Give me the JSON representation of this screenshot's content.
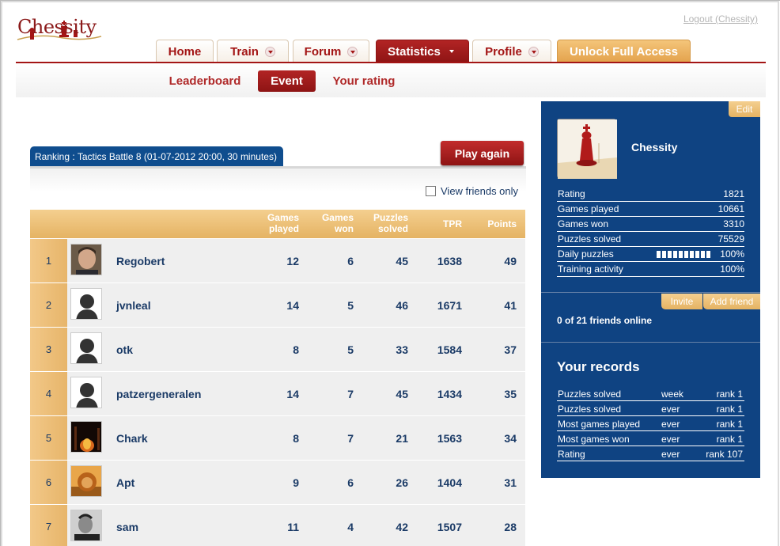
{
  "header": {
    "logo_text": "Chessity",
    "logout": "Logout (Chessity)"
  },
  "nav": {
    "tabs": [
      {
        "label": "Home",
        "dropdown": false,
        "active": false
      },
      {
        "label": "Train",
        "dropdown": true,
        "active": false
      },
      {
        "label": "Forum",
        "dropdown": true,
        "active": false
      },
      {
        "label": "Statistics",
        "dropdown": true,
        "active": true
      },
      {
        "label": "Profile",
        "dropdown": true,
        "active": false
      },
      {
        "label": "Unlock Full Access",
        "dropdown": false,
        "active": false
      }
    ],
    "subtabs": [
      {
        "label": "Leaderboard",
        "active": false
      },
      {
        "label": "Event",
        "active": true
      },
      {
        "label": "Your rating",
        "active": false
      }
    ]
  },
  "ranking": {
    "label": "Ranking : Tactics Battle 8 (01-07-2012 20:00, 30 minutes)",
    "play_again": "Play again",
    "view_friends": "View friends only",
    "view_friends_checked": false
  },
  "table": {
    "headers": {
      "games_played": [
        "Games",
        "played"
      ],
      "games_won": [
        "Games",
        "won"
      ],
      "puzzles_solved": [
        "Puzzles",
        "solved"
      ],
      "tpr": "TPR",
      "points": "Points"
    },
    "rows": [
      {
        "rank": "1",
        "name": "Regobert",
        "avatar": "photo-man",
        "played": "12",
        "won": "6",
        "solved": "45",
        "tpr": "1638",
        "points": "49"
      },
      {
        "rank": "2",
        "name": "jvnleal",
        "avatar": "silhouette",
        "played": "14",
        "won": "5",
        "solved": "46",
        "tpr": "1671",
        "points": "41"
      },
      {
        "rank": "3",
        "name": "otk",
        "avatar": "silhouette",
        "played": "8",
        "won": "5",
        "solved": "33",
        "tpr": "1584",
        "points": "37"
      },
      {
        "rank": "4",
        "name": "patzergeneralen",
        "avatar": "silhouette",
        "played": "14",
        "won": "7",
        "solved": "45",
        "tpr": "1434",
        "points": "35"
      },
      {
        "rank": "5",
        "name": "Chark",
        "avatar": "photo-fire",
        "played": "8",
        "won": "7",
        "solved": "21",
        "tpr": "1563",
        "points": "34"
      },
      {
        "rank": "6",
        "name": "Apt",
        "avatar": "photo-lion",
        "played": "9",
        "won": "6",
        "solved": "26",
        "tpr": "1404",
        "points": "31"
      },
      {
        "rank": "7",
        "name": "sam",
        "avatar": "photo-bw",
        "played": "11",
        "won": "4",
        "solved": "42",
        "tpr": "1507",
        "points": "28"
      }
    ]
  },
  "sidebar": {
    "edit": "Edit",
    "profile_name": "Chessity",
    "stats": [
      {
        "label": "Rating",
        "value": "1821"
      },
      {
        "label": "Games played",
        "value": "10661"
      },
      {
        "label": "Games won",
        "value": "3310"
      },
      {
        "label": "Puzzles solved",
        "value": "75529"
      },
      {
        "label": "Daily puzzles",
        "value": "100%",
        "meter_fraction": 1.0
      },
      {
        "label": "Training activity",
        "value": "100%"
      }
    ],
    "invite": "Invite",
    "add_friend": "Add friend",
    "friends_online": "0 of 21 friends online",
    "records_title": "Your records",
    "records": [
      {
        "label": "Puzzles solved",
        "period": "week",
        "rank": "rank 1"
      },
      {
        "label": "Puzzles solved",
        "period": "ever",
        "rank": "rank 1"
      },
      {
        "label": "Most games played",
        "period": "ever",
        "rank": "rank 1"
      },
      {
        "label": "Most games won",
        "period": "ever",
        "rank": "rank 1"
      },
      {
        "label": "Rating",
        "period": "ever",
        "rank": "rank 107"
      }
    ]
  },
  "colors": {
    "brand_red": "#a31515",
    "sidebar_blue": "#0f4382",
    "gold": "#e5b363",
    "text_blue": "#1a3a66"
  }
}
